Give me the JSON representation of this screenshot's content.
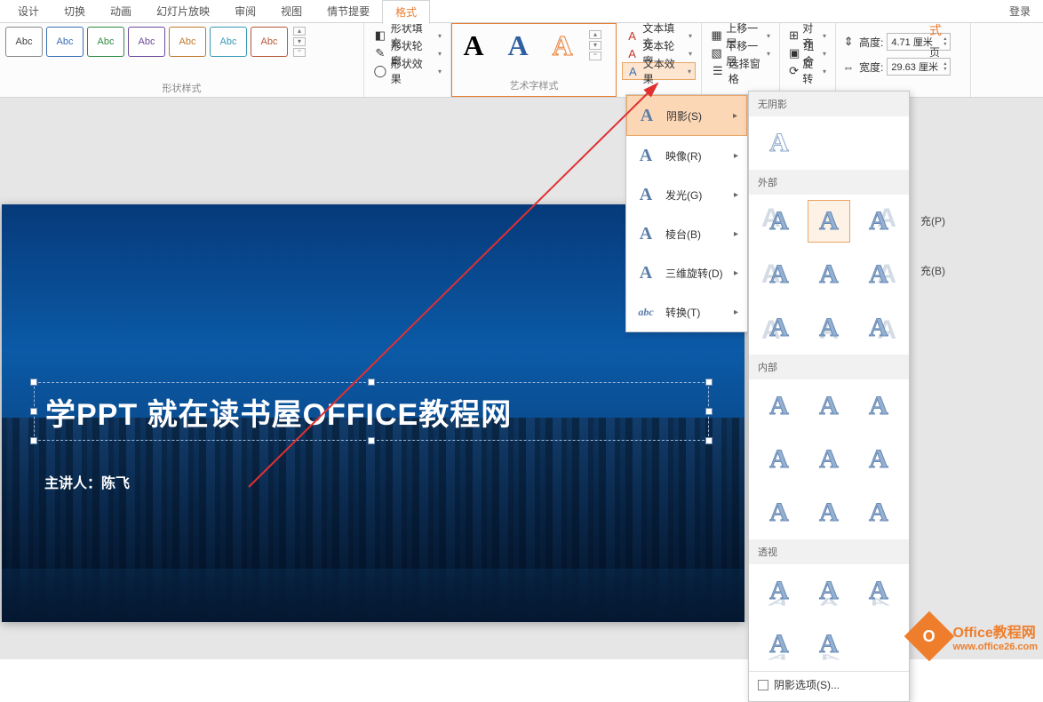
{
  "tabs": {
    "items": [
      "设计",
      "切换",
      "动画",
      "幻灯片放映",
      "审阅",
      "视图",
      "情节提要",
      "格式"
    ],
    "active_index": 7,
    "login": "登录"
  },
  "ribbon": {
    "shapes_label": "Abc",
    "shapes_group_title": "形状样式",
    "shape_fill": "形状填充",
    "shape_outline": "形状轮廓",
    "shape_effects": "形状效果",
    "wordart_group_title": "艺术字样式",
    "text_fill": "文本填充",
    "text_outline": "文本轮廓",
    "text_effects": "文本效果",
    "bring_forward": "上移一层",
    "send_backward": "下移一层",
    "selection_pane": "选择窗格",
    "align": "对齐",
    "group": "组合",
    "rotate": "旋转",
    "height_label": "高度:",
    "height_value": "4.71 厘米",
    "width_label": "宽度:",
    "width_value": "29.63 厘米"
  },
  "text_effects_menu": {
    "items": [
      {
        "label": "阴影(S)",
        "icon": "A"
      },
      {
        "label": "映像(R)",
        "icon": "A"
      },
      {
        "label": "发光(G)",
        "icon": "A"
      },
      {
        "label": "棱台(B)",
        "icon": "A"
      },
      {
        "label": "三维旋转(D)",
        "icon": "A"
      },
      {
        "label": "转换(T)",
        "icon": "abc"
      }
    ],
    "selected_index": 0
  },
  "shadow_gallery": {
    "none_header": "无阴影",
    "outer_header": "外部",
    "inner_header": "内部",
    "perspective_header": "透视",
    "options": "阴影选项(S)...",
    "glyph": "A"
  },
  "slide": {
    "title": "学PPT 就在读书屋OFFICE教程网",
    "presenter": "主讲人：陈飞"
  },
  "rightpanel": {
    "hint1": "式",
    "hint2": "页",
    "opt1": "充(P)",
    "opt2": "充(B)"
  },
  "watermark": {
    "line1": "Office教程网",
    "line2": "www.office26.com",
    "logo": "O"
  }
}
